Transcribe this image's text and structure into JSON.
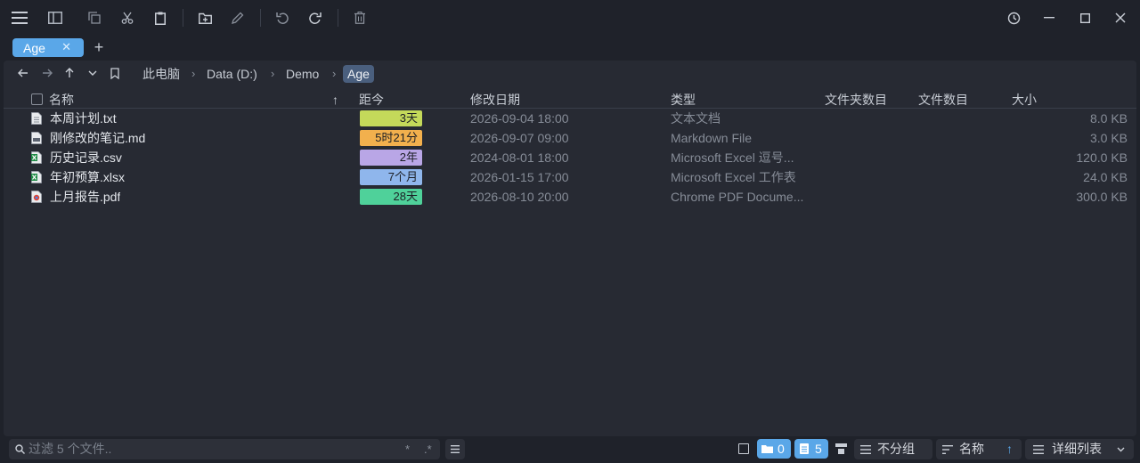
{
  "tabs": [
    {
      "label": "Age",
      "close": "✕"
    }
  ],
  "tab_add": "+",
  "breadcrumb": [
    "此电脑",
    "Data (D:)",
    "Demo",
    "Age"
  ],
  "breadcrumb_sep": "›",
  "columns": {
    "name": "名称",
    "age": "距今",
    "modified": "修改日期",
    "type": "类型",
    "folder_count": "文件夹数目",
    "file_count": "文件数目",
    "size": "大小"
  },
  "sort_arrow": "↑",
  "files": [
    {
      "name": "本周计划.txt",
      "age": "3天",
      "age_color": "#c4d95a",
      "modified": "2026-09-04 18:00",
      "type": "文本文档",
      "size": "8.0 KB",
      "icon": "text-file-icon"
    },
    {
      "name": "刚修改的笔记.md",
      "age": "5时21分",
      "age_color": "#f2b04d",
      "modified": "2026-09-07 09:00",
      "type": "Markdown File",
      "size": "3.0 KB",
      "icon": "markdown-file-icon"
    },
    {
      "name": "历史记录.csv",
      "age": "2年",
      "age_color": "#b9a6e6",
      "modified": "2024-08-01 18:00",
      "type": "Microsoft Excel 逗号...",
      "size": "120.0 KB",
      "icon": "excel-file-icon"
    },
    {
      "name": "年初预算.xlsx",
      "age": "7个月",
      "age_color": "#8fb6ec",
      "modified": "2026-01-15 17:00",
      "type": "Microsoft Excel 工作表",
      "size": "24.0 KB",
      "icon": "excel-file-icon"
    },
    {
      "name": "上月报告.pdf",
      "age": "28天",
      "age_color": "#4fd19a",
      "modified": "2026-08-10 20:00",
      "type": "Chrome PDF Docume...",
      "size": "300.0 KB",
      "icon": "pdf-file-icon"
    }
  ],
  "status": {
    "filter_placeholder": "过滤 5 个文件..",
    "filter_star": "*",
    "filter_regex": ".*",
    "folder_count": "0",
    "file_count": "5",
    "group": "不分组",
    "sort": "名称",
    "sort_dir": "↑",
    "view": "详细列表"
  },
  "colors": {
    "accent": "#5aa7e8",
    "background": "#1f222a",
    "panel": "#272a33"
  }
}
